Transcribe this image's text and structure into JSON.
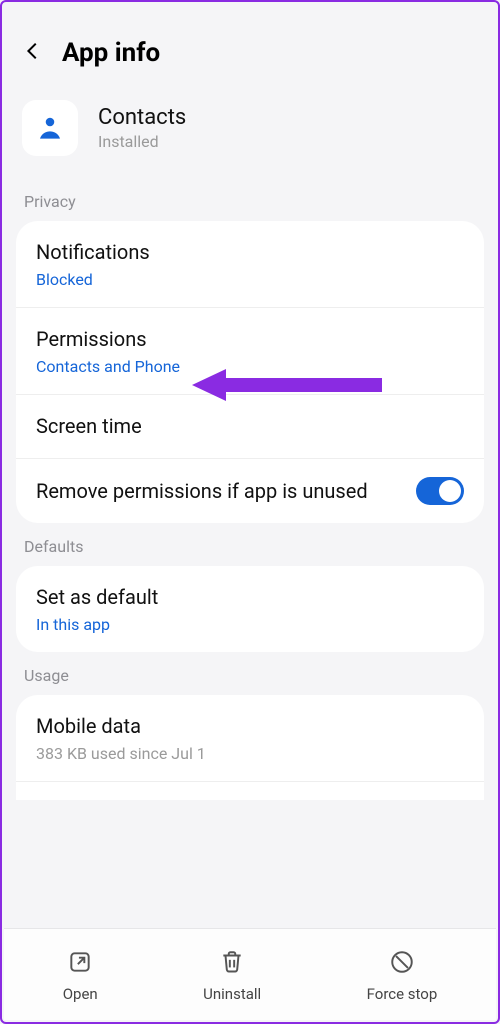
{
  "header": {
    "title": "App info"
  },
  "app": {
    "name": "Contacts",
    "status": "Installed"
  },
  "sections": {
    "privacy": {
      "label": "Privacy",
      "notifications": {
        "title": "Notifications",
        "sub": "Blocked"
      },
      "permissions": {
        "title": "Permissions",
        "sub": "Contacts and Phone"
      },
      "screentime": {
        "title": "Screen time"
      },
      "removeperms": {
        "title": "Remove permissions if app is unused",
        "toggle": true
      }
    },
    "defaults": {
      "label": "Defaults",
      "setdefault": {
        "title": "Set as default",
        "sub": "In this app"
      }
    },
    "usage": {
      "label": "Usage",
      "mobiledata": {
        "title": "Mobile data",
        "sub": "383 KB used since Jul 1"
      }
    }
  },
  "bottom": {
    "open": "Open",
    "uninstall": "Uninstall",
    "forcestop": "Force stop"
  },
  "colors": {
    "accent": "#1565d8",
    "annotation": "#8a2be2"
  }
}
